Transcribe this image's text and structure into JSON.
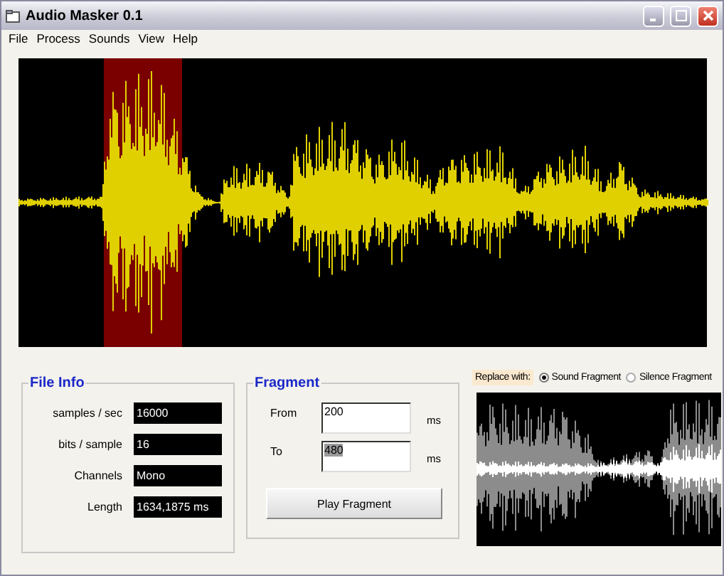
{
  "window": {
    "title": "Audio Masker 0.1"
  },
  "menu": [
    {
      "label": "File"
    },
    {
      "label": "Process"
    },
    {
      "label": "Sounds"
    },
    {
      "label": "View"
    },
    {
      "label": "Help"
    }
  ],
  "file_info": {
    "title": "File Info",
    "fields": [
      {
        "label": "samples / sec",
        "value": "16000"
      },
      {
        "label": "bits / sample",
        "value": "16"
      },
      {
        "label": "Channels",
        "value": "Mono"
      },
      {
        "label": "Length",
        "value": "1634,1875 ms"
      }
    ]
  },
  "fragment": {
    "title": "Fragment",
    "fields": [
      {
        "label": "From",
        "value": "200",
        "unit": "ms",
        "text_selected": false
      },
      {
        "label": "To",
        "value": "480",
        "unit": "ms",
        "text_selected": true
      }
    ],
    "button": "Play Fragment"
  },
  "replace": {
    "label": "Replace with:",
    "options": [
      {
        "label": "Sound Fragment",
        "selected": true
      },
      {
        "label": "Silence Fragment",
        "selected": false
      }
    ]
  }
}
